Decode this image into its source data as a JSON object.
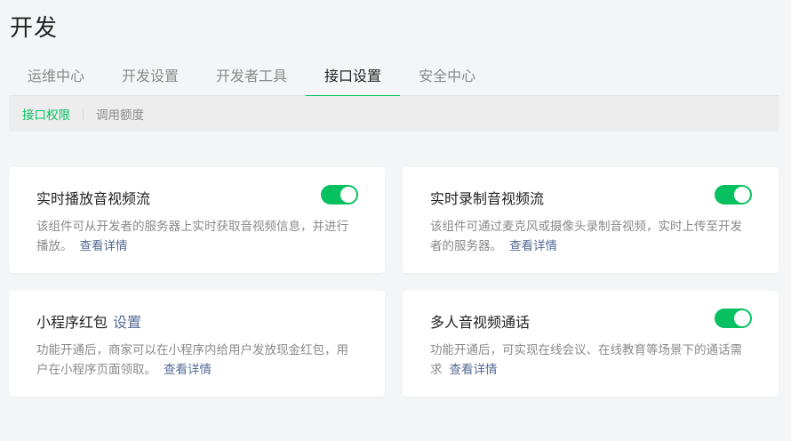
{
  "page": {
    "title": "开发"
  },
  "tabs": [
    {
      "label": "运维中心"
    },
    {
      "label": "开发设置"
    },
    {
      "label": "开发者工具"
    },
    {
      "label": "接口设置",
      "active": true
    },
    {
      "label": "安全中心"
    }
  ],
  "subnav": [
    {
      "label": "接口权限",
      "active": true
    },
    {
      "label": "调用额度"
    }
  ],
  "cards": [
    {
      "title": "实时播放音视频流",
      "description": "该组件可从开发者的服务器上实时获取音视频信息，并进行播放。",
      "detail_link": "查看详情",
      "toggle_on": true
    },
    {
      "title": "实时录制音视频流",
      "description": "该组件可通过麦克风或摄像头录制音视频，实时上传至开发者的服务器。",
      "detail_link": "查看详情",
      "toggle_on": true
    },
    {
      "title": "小程序红包",
      "title_link": "设置",
      "description": "功能开通后，商家可以在小程序内给用户发放现金红包，用户在小程序页面领取。",
      "detail_link": "查看详情"
    },
    {
      "title": "多人音视频通话",
      "description": "功能开通后，可实现在线会议、在线教育等场景下的通话需求",
      "detail_link": "查看详情",
      "toggle_on": true
    }
  ],
  "colors": {
    "accent": "#07c160",
    "link": "#576b95",
    "background": "#f4f5f6"
  }
}
